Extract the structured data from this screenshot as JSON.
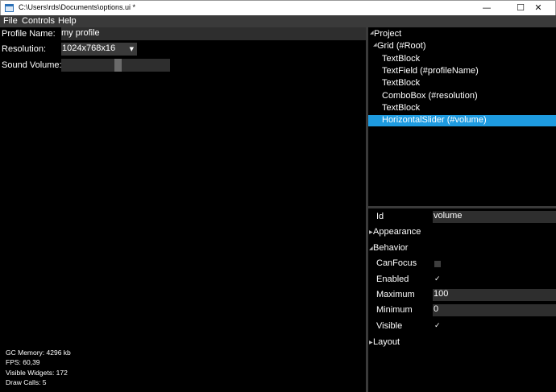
{
  "window": {
    "title": "C:\\Users\\rds\\Documents\\options.ui *",
    "minimize_glyph": "—",
    "maximize_glyph": "☐",
    "close_glyph": "✕"
  },
  "menu": {
    "items": [
      "File",
      "Controls",
      "Help"
    ]
  },
  "canvas": {
    "profile_label": "Profile Name:",
    "profile_value": "my profile",
    "resolution_label": "Resolution:",
    "resolution_value": "1024x768x16",
    "sound_label": "Sound Volume:",
    "sound_volume_fraction": 0.52
  },
  "stats": {
    "gc_memory": "GC Memory: 4296 kb",
    "fps": "FPS: 60,39",
    "visible_widgets": "Visible Widgets: 172",
    "draw_calls": "Draw Calls: 5"
  },
  "tree": {
    "root": "Project",
    "grid": "Grid (#Root)",
    "children": [
      "TextBlock",
      "TextField (#profileName)",
      "TextBlock",
      "ComboBox (#resolution)",
      "TextBlock",
      "HorizontalSlider (#volume)"
    ],
    "selected_index": 5,
    "selected_color": "#1e9be0"
  },
  "properties": {
    "id_label": "Id",
    "id_value": "volume",
    "appearance_label": "Appearance",
    "behavior_label": "Behavior",
    "canfocus_label": "CanFocus",
    "canfocus_checked": false,
    "enabled_label": "Enabled",
    "enabled_checked": true,
    "maximum_label": "Maximum",
    "maximum_value": "100",
    "minimum_label": "Minimum",
    "minimum_value": "0",
    "visible_label": "Visible",
    "visible_checked": true,
    "layout_label": "Layout",
    "check_glyph": "✓"
  }
}
